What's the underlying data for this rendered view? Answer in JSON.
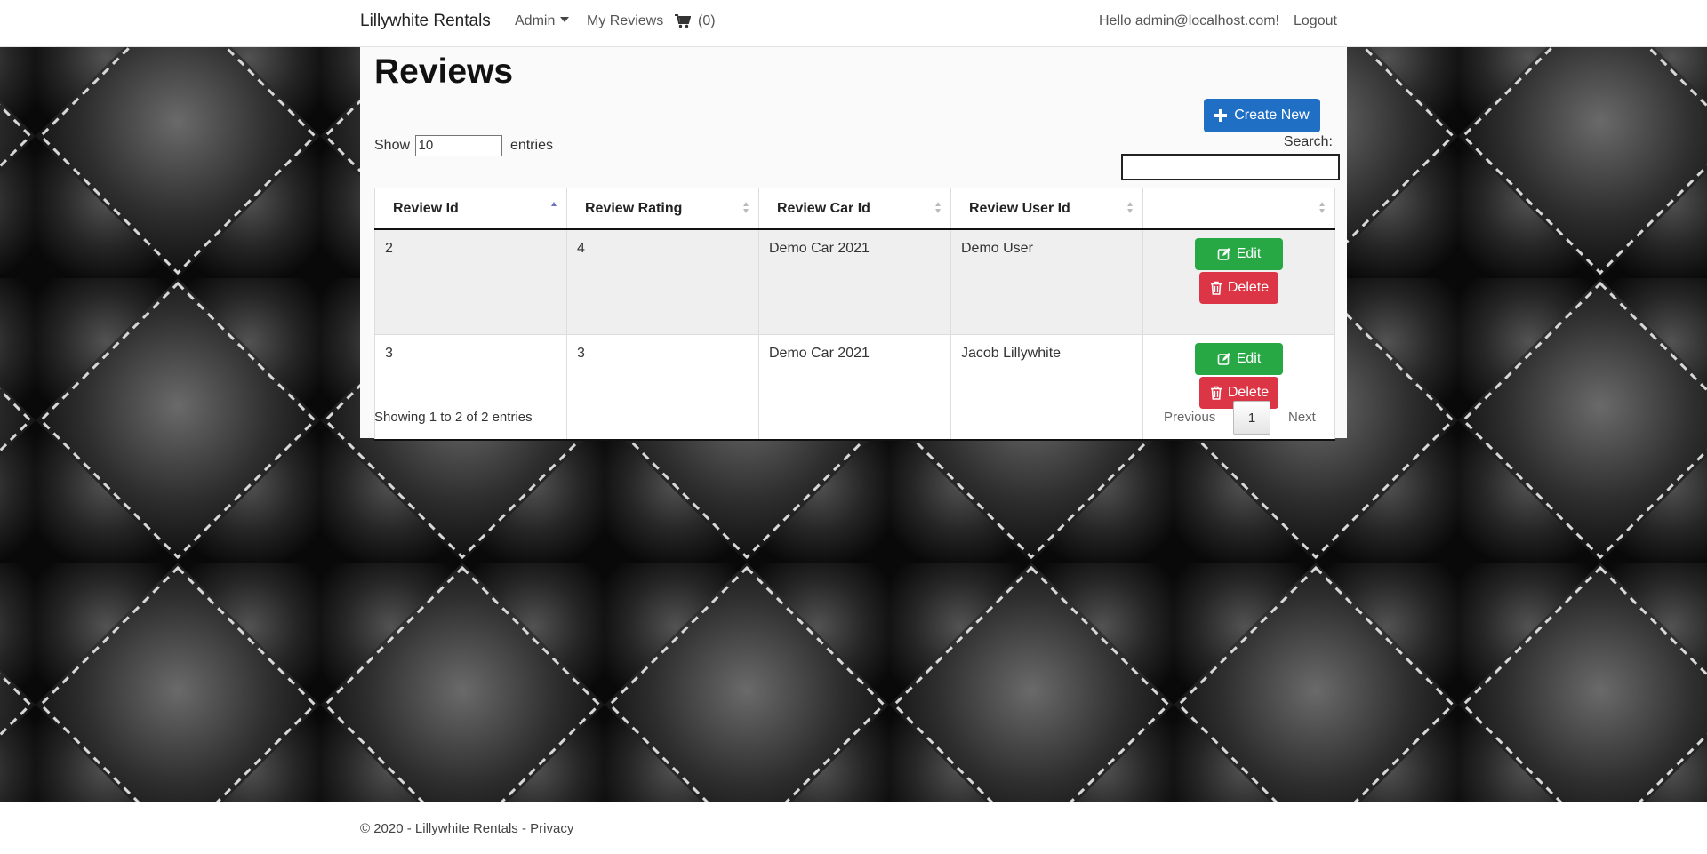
{
  "navbar": {
    "brand": "Lillywhite Rentals",
    "admin_label": "Admin",
    "my_reviews_label": "My Reviews",
    "cart_count": "(0)",
    "greeting": "Hello admin@localhost.com!",
    "logout_label": "Logout"
  },
  "page": {
    "title": "Reviews",
    "create_label": "Create New"
  },
  "table_controls": {
    "show_label": "Show",
    "page_length": "10",
    "entries_label": "entries",
    "search_label": "Search:",
    "search_value": ""
  },
  "table": {
    "columns": [
      "Review Id",
      "Review Rating",
      "Review Car Id",
      "Review User Id",
      ""
    ],
    "rows": [
      {
        "id": "2",
        "rating": "4",
        "car": "Demo Car 2021",
        "user": "Demo User",
        "edit": "Edit",
        "delete": "Delete"
      },
      {
        "id": "3",
        "rating": "3",
        "car": "Demo Car 2021",
        "user": "Jacob Lillywhite",
        "edit": "Edit",
        "delete": "Delete"
      }
    ],
    "info": "Showing 1 to 2 of 2 entries",
    "pagination": {
      "previous": "Previous",
      "current": "1",
      "next": "Next"
    }
  },
  "footer": {
    "copyright": "© 2020 - Lillywhite Rentals - ",
    "privacy_label": "Privacy"
  },
  "colors": {
    "primary": "#1f6fc5",
    "success": "#28a745",
    "danger": "#dc3545"
  }
}
